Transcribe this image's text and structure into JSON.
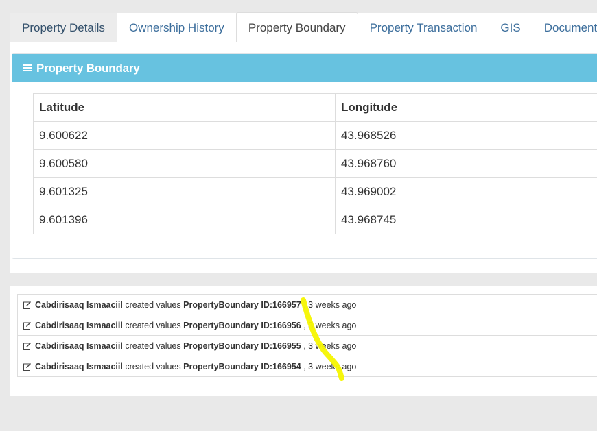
{
  "tabs": [
    {
      "label": "Property Details",
      "active": false
    },
    {
      "label": "Ownership History",
      "active": false
    },
    {
      "label": "Property Boundary",
      "active": true
    },
    {
      "label": "Property Transaction",
      "active": false
    },
    {
      "label": "GIS",
      "active": false
    },
    {
      "label": "Documents",
      "active": false
    }
  ],
  "panel": {
    "title": "Property Boundary",
    "icon": "list-icon",
    "header_color": "#67c2e0"
  },
  "table": {
    "columns": [
      "Latitude",
      "Longitude"
    ],
    "rows": [
      [
        "9.600622",
        "43.968526"
      ],
      [
        "9.600580",
        "43.968760"
      ],
      [
        "9.601325",
        "43.969002"
      ],
      [
        "9.601396",
        "43.968745"
      ]
    ]
  },
  "activity": [
    {
      "user": "Cabdirisaaq Ismaaciil",
      "action": "created values",
      "entity": "PropertyBoundary ID:166957",
      "sep": ",",
      "time": "3 weeks ago",
      "icon": "edit-icon"
    },
    {
      "user": "Cabdirisaaq Ismaaciil",
      "action": "created values",
      "entity": "PropertyBoundary ID:166956",
      "sep": ",",
      "time": "3 weeks ago",
      "icon": "edit-icon"
    },
    {
      "user": "Cabdirisaaq Ismaaciil",
      "action": "created values",
      "entity": "PropertyBoundary ID:166955",
      "sep": ",",
      "time": "3 weeks ago",
      "icon": "edit-icon"
    },
    {
      "user": "Cabdirisaaq Ismaaciil",
      "action": "created values",
      "entity": "PropertyBoundary ID:166954",
      "sep": ",",
      "time": "3 weeks ago",
      "icon": "edit-icon"
    }
  ],
  "annotation_color": "#f5f500"
}
